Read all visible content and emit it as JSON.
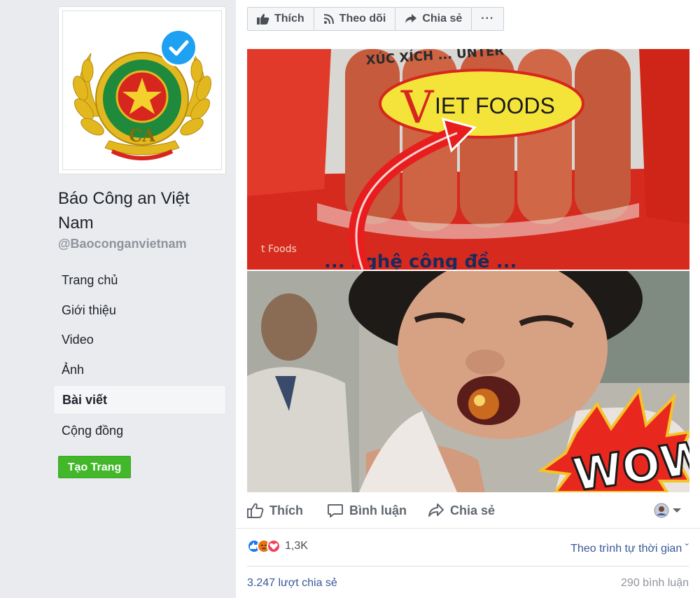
{
  "page": {
    "name": "Báo Công an Việt Nam",
    "handle": "@Baoconganvietnam"
  },
  "nav": {
    "items": [
      "Trang chủ",
      "Giới thiệu",
      "Video",
      "Ảnh",
      "Bài viết",
      "Cộng đồng"
    ],
    "active_index": 4,
    "create_page_label": "Tạo Trang"
  },
  "topbar": {
    "like_label": "Thích",
    "follow_label": "Theo dõi",
    "share_label": "Chia sẻ",
    "more_label": "···"
  },
  "post": {
    "image_top_text": {
      "brand": "IET FOODS",
      "brand_initial": "V",
      "top_arc": "XÚC XÍCH ... UNTER",
      "bottom_text": "... nghệ công đề ...",
      "side_text": "t Foods"
    },
    "image_bottom_text": {
      "badge": "WOW"
    },
    "actions": {
      "like": "Thích",
      "comment": "Bình luận",
      "share": "Chia sẻ"
    },
    "reaction_count": "1,3K",
    "sort_label": "Theo trình tự thời gian ˇ",
    "shares": "3.247 lượt chia sẻ",
    "comments": "290 bình luận"
  },
  "colors": {
    "accent": "#385898",
    "create_button": "#42b72a",
    "verified": "#1da1f2",
    "like_blue": "#1877f2",
    "love_red": "#f33e58",
    "angry_orange": "#e9710f"
  },
  "icons": {
    "verified": "check-badge-icon",
    "like": "thumbs-up-icon",
    "follow": "rss-icon",
    "share": "share-arrow-icon",
    "comment": "speech-bubble-icon"
  }
}
